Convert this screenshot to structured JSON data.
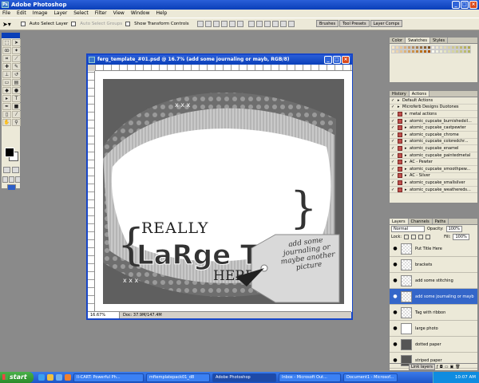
{
  "app": {
    "title": "Adobe Photoshop"
  },
  "menu": [
    "File",
    "Edit",
    "Image",
    "Layer",
    "Select",
    "Filter",
    "View",
    "Window",
    "Help"
  ],
  "options": {
    "auto_select_layer": "Auto Select Layer",
    "auto_select_groups": "Auto Select Groups",
    "show_transform_controls": "Show Transform Controls"
  },
  "palette_well": [
    "Brushes",
    "Tool Presets",
    "Layer Comps"
  ],
  "document": {
    "title": "ferg_template_#01.psd @ 16.7% (add some  journaling or mayb, RGB/8)",
    "zoom": "16.67%",
    "doc_size": "Doc: 37.9M/147.4M",
    "artwork": {
      "title_small": "REALLY",
      "title_big": "LaRge Title",
      "title_here": "HERE",
      "journal_text": "add some journaling or maybe another picture",
      "stitch_marks": "x x x"
    }
  },
  "color_panel": {
    "tabs": [
      "Color",
      "Swatches",
      "Styles"
    ],
    "active": "Swatches"
  },
  "actions_panel": {
    "tabs": [
      "History",
      "Actions"
    ],
    "active": "Actions",
    "items": [
      {
        "label": "Default Actions",
        "type": "set"
      },
      {
        "label": "Microferb Designs Duotones",
        "type": "set"
      },
      {
        "label": "metal actions",
        "type": "set-open"
      },
      {
        "label": "atomic_cupcake_burnishedsil...",
        "type": "action"
      },
      {
        "label": "atomic_cupcake_castpewter",
        "type": "action"
      },
      {
        "label": "atomic_cupcake_chrome",
        "type": "action"
      },
      {
        "label": "atomic_cupcake_coloredchr...",
        "type": "action"
      },
      {
        "label": "atomic_cupcake_enamel",
        "type": "action"
      },
      {
        "label": "atomic_cupcake_paintedmetal",
        "type": "action"
      },
      {
        "label": "AC - Pewter",
        "type": "action"
      },
      {
        "label": "atomic_cupcake_smoothpew...",
        "type": "action"
      },
      {
        "label": "AC - Silver",
        "type": "action"
      },
      {
        "label": "atomic_cupcake_smallsilver",
        "type": "action"
      },
      {
        "label": "atomic_cupcake_weathereds...",
        "type": "action"
      }
    ]
  },
  "layers_panel": {
    "tabs": [
      "Layers",
      "Channels",
      "Paths"
    ],
    "active": "Layers",
    "blend_mode": "Normal",
    "opacity_label": "Opacity:",
    "opacity": "100%",
    "lock_label": "Lock:",
    "fill_label": "Fill:",
    "fill": "100%",
    "layers": [
      {
        "name": "Put Title Here",
        "thumb": "checker",
        "selected": false
      },
      {
        "name": "brackets",
        "thumb": "checker",
        "selected": false
      },
      {
        "name": "add some stitching",
        "thumb": "checker",
        "selected": false
      },
      {
        "name": "add some  journaling or mayb",
        "thumb": "checker",
        "selected": true
      },
      {
        "name": "Tag with ribbon",
        "thumb": "checker",
        "selected": false
      },
      {
        "name": "large photo",
        "thumb": "white",
        "selected": false
      },
      {
        "name": "dotted paper",
        "thumb": "solid",
        "selected": false
      },
      {
        "name": "striped paper",
        "thumb": "solid",
        "selected": false
      }
    ],
    "footer": "Link layers"
  },
  "taskbar": {
    "start": "start",
    "items": [
      {
        "label": "II-CART: Powerful Ph...",
        "active": false
      },
      {
        "label": "mftemplatepack01_d8",
        "active": false
      },
      {
        "label": "Adobe Photoshop",
        "active": true
      },
      {
        "label": "Inbox - Microsoft Out...",
        "active": false
      },
      {
        "label": "Document1 - Microsof...",
        "active": false
      }
    ],
    "clock": "10:07 AM"
  },
  "colors": {
    "xp_blue": "#0a3fb8",
    "selected_layer": "#3466c9",
    "action_box": "#c0504d"
  }
}
